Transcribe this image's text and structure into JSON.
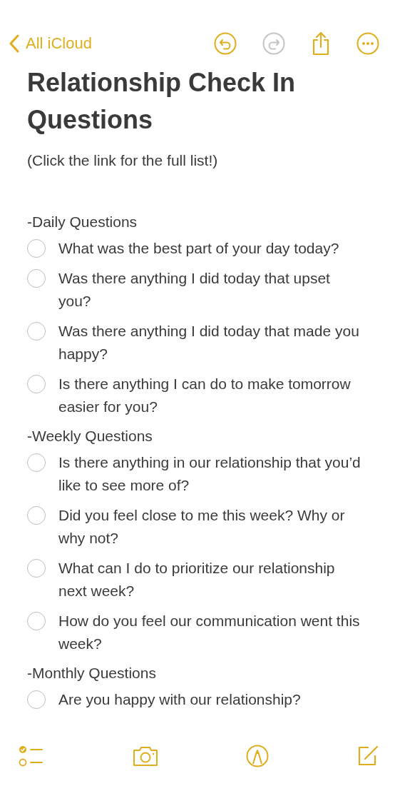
{
  "nav": {
    "back_label": "All iCloud",
    "undo_disabled": false,
    "redo_disabled": true
  },
  "note": {
    "title": "Relationship Check In Questions",
    "subtitle": "(Click the link for the full list!)",
    "sections": [
      {
        "heading": "-Daily Questions",
        "items": [
          {
            "text": "What was the best part of your day today?",
            "checked": false
          },
          {
            "text": "Was there anything I did today that upset you?",
            "checked": false
          },
          {
            "text": "Was there anything I did today that made you happy?",
            "checked": false
          },
          {
            "text": "Is there anything I can do to make tomorrow easier for you?",
            "checked": false
          }
        ]
      },
      {
        "heading": "-Weekly Questions",
        "items": [
          {
            "text": "Is there anything in our relationship that you’d like to see more of?",
            "checked": false
          },
          {
            "text": "Did you feel close to me this week? Why or why not?",
            "checked": false
          },
          {
            "text": "What can I do to prioritize our relationship next week?",
            "checked": false
          },
          {
            "text": "How do you feel our communication went this week?",
            "checked": false
          }
        ]
      },
      {
        "heading": "-Monthly Questions",
        "items": [
          {
            "text": "Are you happy with our relationship?",
            "checked": false
          }
        ]
      }
    ]
  }
}
